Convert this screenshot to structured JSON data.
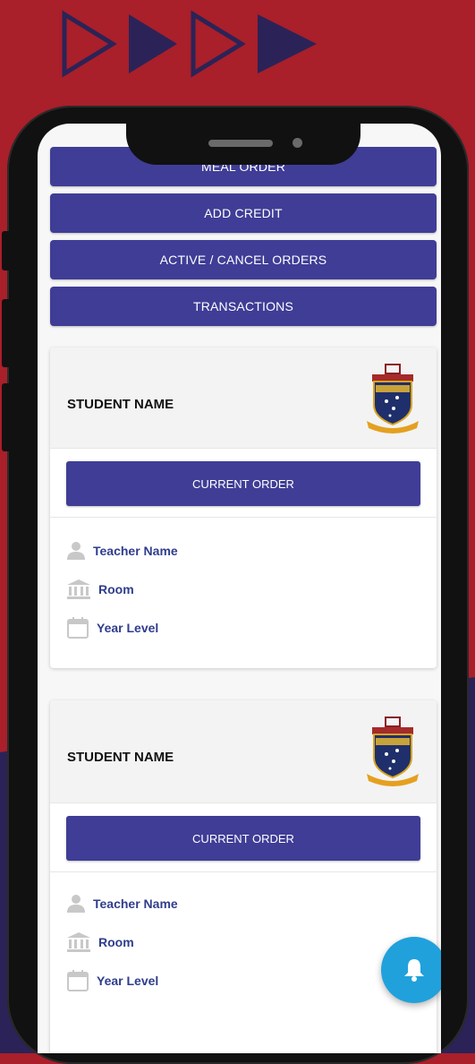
{
  "colors": {
    "background_red": "#a91f2a",
    "background_navy": "#2b2357",
    "button_primary": "#3f3d96",
    "fab": "#20a1dc",
    "info_text": "#2f3d8c"
  },
  "menu": {
    "meal_order": "MEAL ORDER",
    "add_credit": "ADD CREDIT",
    "active_cancel_orders": "ACTIVE / CANCEL ORDERS",
    "transactions": "TRANSACTIONS"
  },
  "students": [
    {
      "name": "STUDENT NAME",
      "current_order_label": "CURRENT ORDER",
      "teacher": "Teacher Name",
      "room": "Room",
      "year_level": "Year Level"
    },
    {
      "name": "STUDENT NAME",
      "current_order_label": "CURRENT ORDER",
      "teacher": "Teacher Name",
      "room": "Room",
      "year_level": "Year Level"
    }
  ],
  "icons": {
    "teacher": "person-icon",
    "room": "building-icon",
    "year_level": "calendar-icon",
    "fab": "bell-icon",
    "crest": "school-crest-logo"
  }
}
